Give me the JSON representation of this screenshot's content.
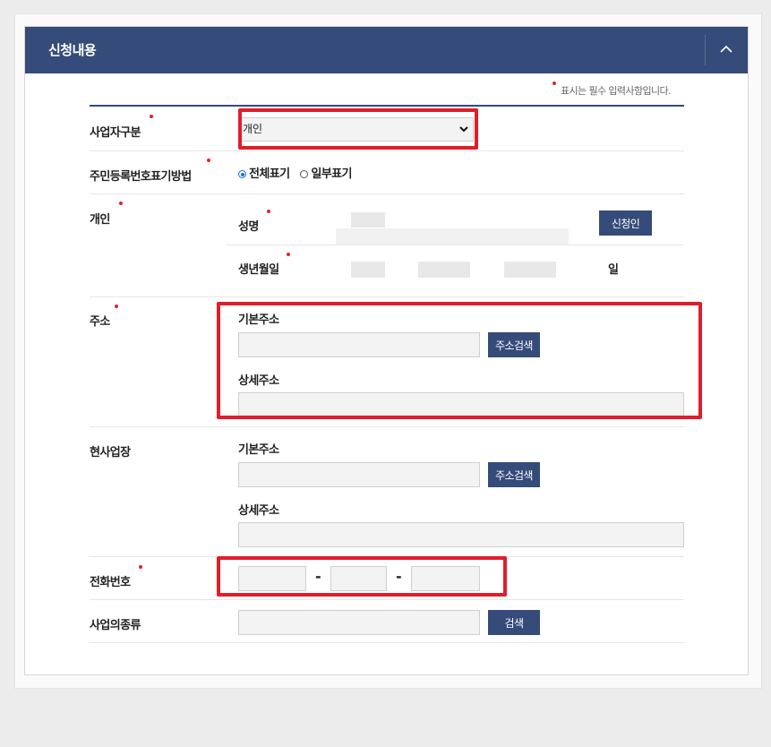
{
  "panel": {
    "title": "신청내용"
  },
  "required_note": "표시는 필수 입력사항입니다.",
  "fields": {
    "business_type": {
      "label": "사업자구분",
      "value": "개인"
    },
    "id_display": {
      "label": "주민등록번호표기방법",
      "options": [
        "전체표기",
        "일부표기"
      ],
      "selected": "전체표기"
    },
    "individual": {
      "label": "개인",
      "name_label": "성명",
      "birth_label": "생년월일",
      "day_suffix": "일",
      "applicant_button": "신청인"
    },
    "address": {
      "label": "주소",
      "basic_label": "기본주소",
      "detail_label": "상세주소",
      "search_button": "주소검색"
    },
    "workplace": {
      "label": "현사업장",
      "basic_label": "기본주소",
      "detail_label": "상세주소",
      "search_button": "주소검색"
    },
    "phone": {
      "label": "전화번호",
      "separator": "-"
    },
    "business_kind": {
      "label": "사업의종류",
      "search_button": "검색"
    }
  },
  "colors": {
    "header": "#354b79",
    "required_dot": "#e0242b",
    "highlight_box": "#e21d2a"
  }
}
